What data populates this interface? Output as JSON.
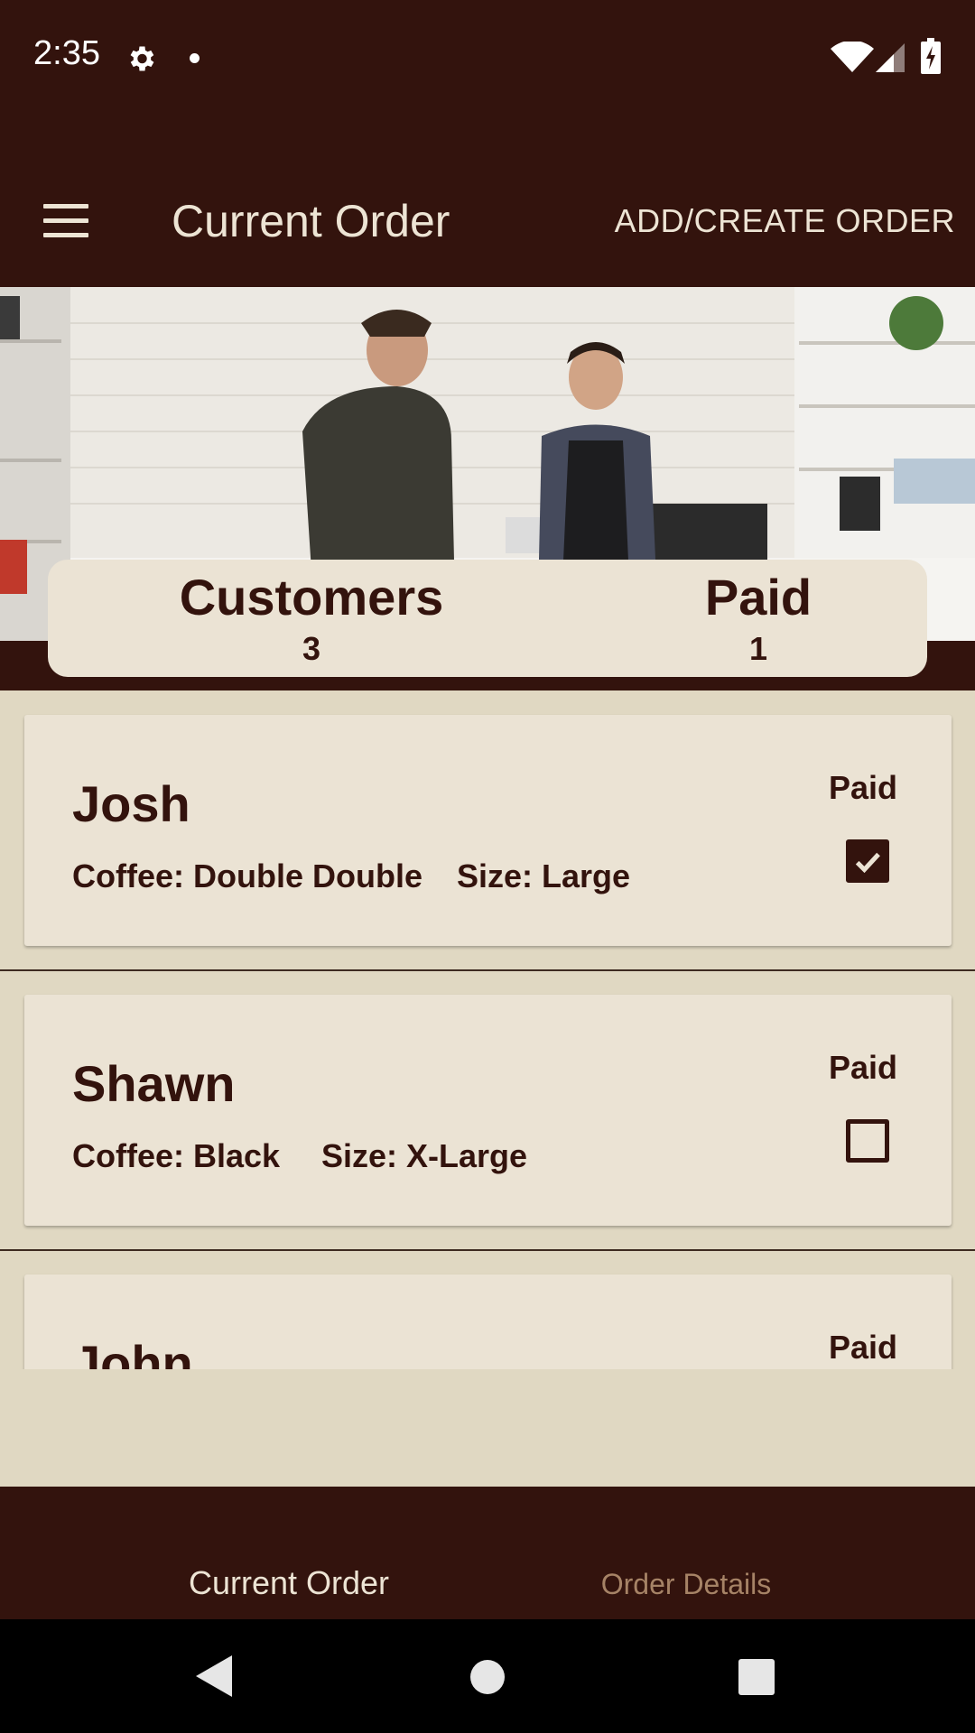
{
  "status_bar": {
    "time": "2:35",
    "icons": [
      "gear-icon",
      "notification-dot",
      "wifi-icon",
      "signal-icon",
      "battery-charging-icon"
    ]
  },
  "app_bar": {
    "title": "Current Order",
    "action_label": "ADD/CREATE ORDER",
    "menu_icon": "hamburger-menu-icon"
  },
  "hero": {
    "image": "photo of a customer and a barista at a coffee shop counter"
  },
  "stats": {
    "customers_label": "Customers",
    "customers_value": "3",
    "paid_label": "Paid",
    "paid_value": "1"
  },
  "orders": [
    {
      "name": "Josh",
      "coffee": "Coffee: Double Double",
      "size": "Size: Large",
      "paid_label": "Paid",
      "paid": true
    },
    {
      "name": "Shawn",
      "coffee": "Coffee: Black",
      "size": "Size: X-Large",
      "paid_label": "Paid",
      "paid": false
    },
    {
      "name": "John",
      "coffee": "",
      "size": "",
      "paid_label": "Paid",
      "paid": false
    }
  ],
  "bottom_nav": {
    "tabs": [
      {
        "label": "Current Order",
        "active": true
      },
      {
        "label": "Order Details",
        "active": false
      }
    ]
  },
  "system_nav": [
    "back-icon",
    "home-icon",
    "recents-icon"
  ],
  "colors": {
    "primary_dark": "#33130d",
    "cream": "#ebe3d4",
    "background": "#e0d8c2",
    "inactive_tab": "#a68366"
  }
}
